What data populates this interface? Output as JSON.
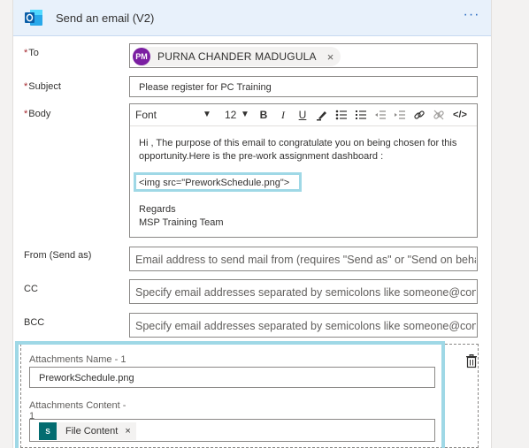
{
  "header": {
    "title": "Send an email (V2)",
    "more": "···"
  },
  "to": {
    "label": "To",
    "recipient_initials": "PM",
    "recipient_name": "PURNA CHANDER MADUGULA",
    "remove": "×"
  },
  "subject": {
    "label": "Subject",
    "value": "Please register for PC Training"
  },
  "body": {
    "label": "Body",
    "toolbar": {
      "font": "Font",
      "size": "12",
      "bold": "B",
      "italic": "I",
      "underline": "U",
      "code": "</>"
    },
    "lines": [
      "Hi , The purpose of this email to congratulate you on being chosen for this",
      "opportunity.Here is the pre-work assignment dashboard :"
    ],
    "img_tag": "<img src=\"PreworkSchedule.png\">",
    "regards": "Regards",
    "signature": "MSP Training Team"
  },
  "from": {
    "label": "From (Send as)",
    "placeholder": "Email address to send mail from (requires \"Send as\" or \"Send on beha"
  },
  "cc": {
    "label": "CC",
    "placeholder": "Specify email addresses separated by semicolons like someone@con"
  },
  "bcc": {
    "label": "BCC",
    "placeholder": "Specify email addresses separated by semicolons like someone@con"
  },
  "attachments": {
    "name_label": "Attachments Name - 1",
    "name_value": "PreworkSchedule.png",
    "content_label_line1": "Attachments Content -",
    "content_label_line2": "1",
    "content_chip_icon": "S",
    "content_chip": "File Content",
    "content_chip_remove": "×"
  },
  "colors": {
    "header_bg": "#e8f1fb",
    "highlight": "#9fd8e6",
    "avatar": "#7b1fa2",
    "required": "#a4262c",
    "sharepoint": "#036c70"
  }
}
